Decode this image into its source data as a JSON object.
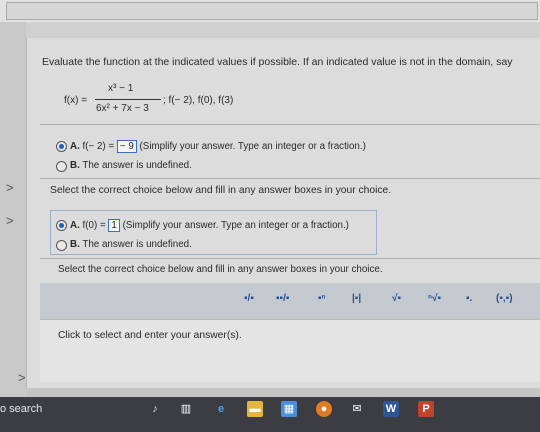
{
  "instruction": "Evaluate the function at the indicated values if possible. If an indicated value is not in the domain, say",
  "function": {
    "lhs": "f(x) =",
    "numerator": "x³ − 1",
    "denominator": "6x² + 7x − 3",
    "evaluate_at": "; f(− 2), f(0), f(3)"
  },
  "part1": {
    "optA_letter": "A.",
    "optA_prefix": "f(− 2) =",
    "optA_answer": "− 9",
    "optA_note": "(Simplify your answer. Type an integer or a fraction.)",
    "optB_letter": "B.",
    "optB_text": "The answer is undefined."
  },
  "prompt1": "Select the correct choice below and fill in any answer boxes in your choice.",
  "part2": {
    "optA_letter": "A.",
    "optA_prefix": "f(0) =",
    "optA_answer": "1",
    "optA_note": "(Simplify your answer. Type an integer or a fraction.)",
    "optB_letter": "B.",
    "optB_text": "The answer is undefined."
  },
  "prompt2": "Select the correct choice below and fill in any answer boxes in your choice.",
  "toolbar_buttons": [
    "▪/▪",
    "▪▪/▪",
    "▪ⁿ",
    "|▪|",
    "√▪",
    "ⁿ√▪",
    "▪.",
    "(▪,▪)"
  ],
  "enter_hint": "Click to select and enter your answer(s).",
  "taskbar": {
    "search_label": "o search",
    "word_label": "W",
    "ppt_label": "P"
  },
  "colors": {
    "accent": "#1f5fb8",
    "taskbar": "#3b3d42"
  }
}
